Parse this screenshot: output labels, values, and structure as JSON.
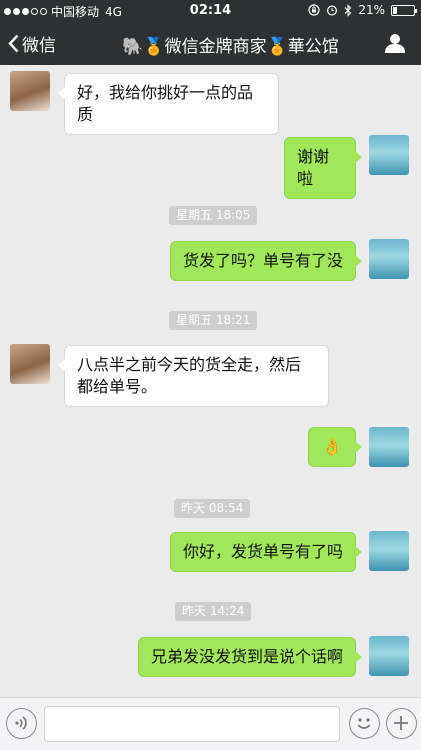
{
  "status_bar": {
    "carrier": "中国移动",
    "network": "4G",
    "time": "02:14",
    "battery": "21%",
    "battery_level": 0.21,
    "icons": [
      "lock-rotation-icon",
      "alarm-icon",
      "bluetooth-icon",
      "battery-icon"
    ]
  },
  "header": {
    "back_label": "微信",
    "title": "🐘🏅微信金牌商家🏅華公馆",
    "profile_icon": "person-icon"
  },
  "messages": [
    {
      "side": "left",
      "text": "好，我给你挑好一点的品质"
    },
    {
      "side": "right",
      "text": "谢谢啦"
    },
    {
      "timestamp": "星期五 18:05"
    },
    {
      "side": "right",
      "text": "货发了吗？单号有了没"
    },
    {
      "timestamp": "星期五 18:21"
    },
    {
      "side": "left",
      "text": "八点半之前今天的货全走，然后都给单号。"
    },
    {
      "side": "right",
      "text": "👌"
    },
    {
      "timestamp": "昨天 08:54"
    },
    {
      "side": "right",
      "text": "你好，发货单号有了吗"
    },
    {
      "timestamp": "昨天 14:24"
    },
    {
      "side": "right",
      "text": "兄弟发没发货到是说个话啊"
    }
  ],
  "input_bar": {
    "voice_icon": "voice-icon",
    "emoji_icon": "emoji-icon",
    "plus_icon": "plus-icon",
    "input_value": ""
  },
  "colors": {
    "bar_bg": "#2e3132",
    "chat_bg": "#ebebeb",
    "bubble_sent": "#a0e75a",
    "bubble_received": "#ffffff"
  }
}
